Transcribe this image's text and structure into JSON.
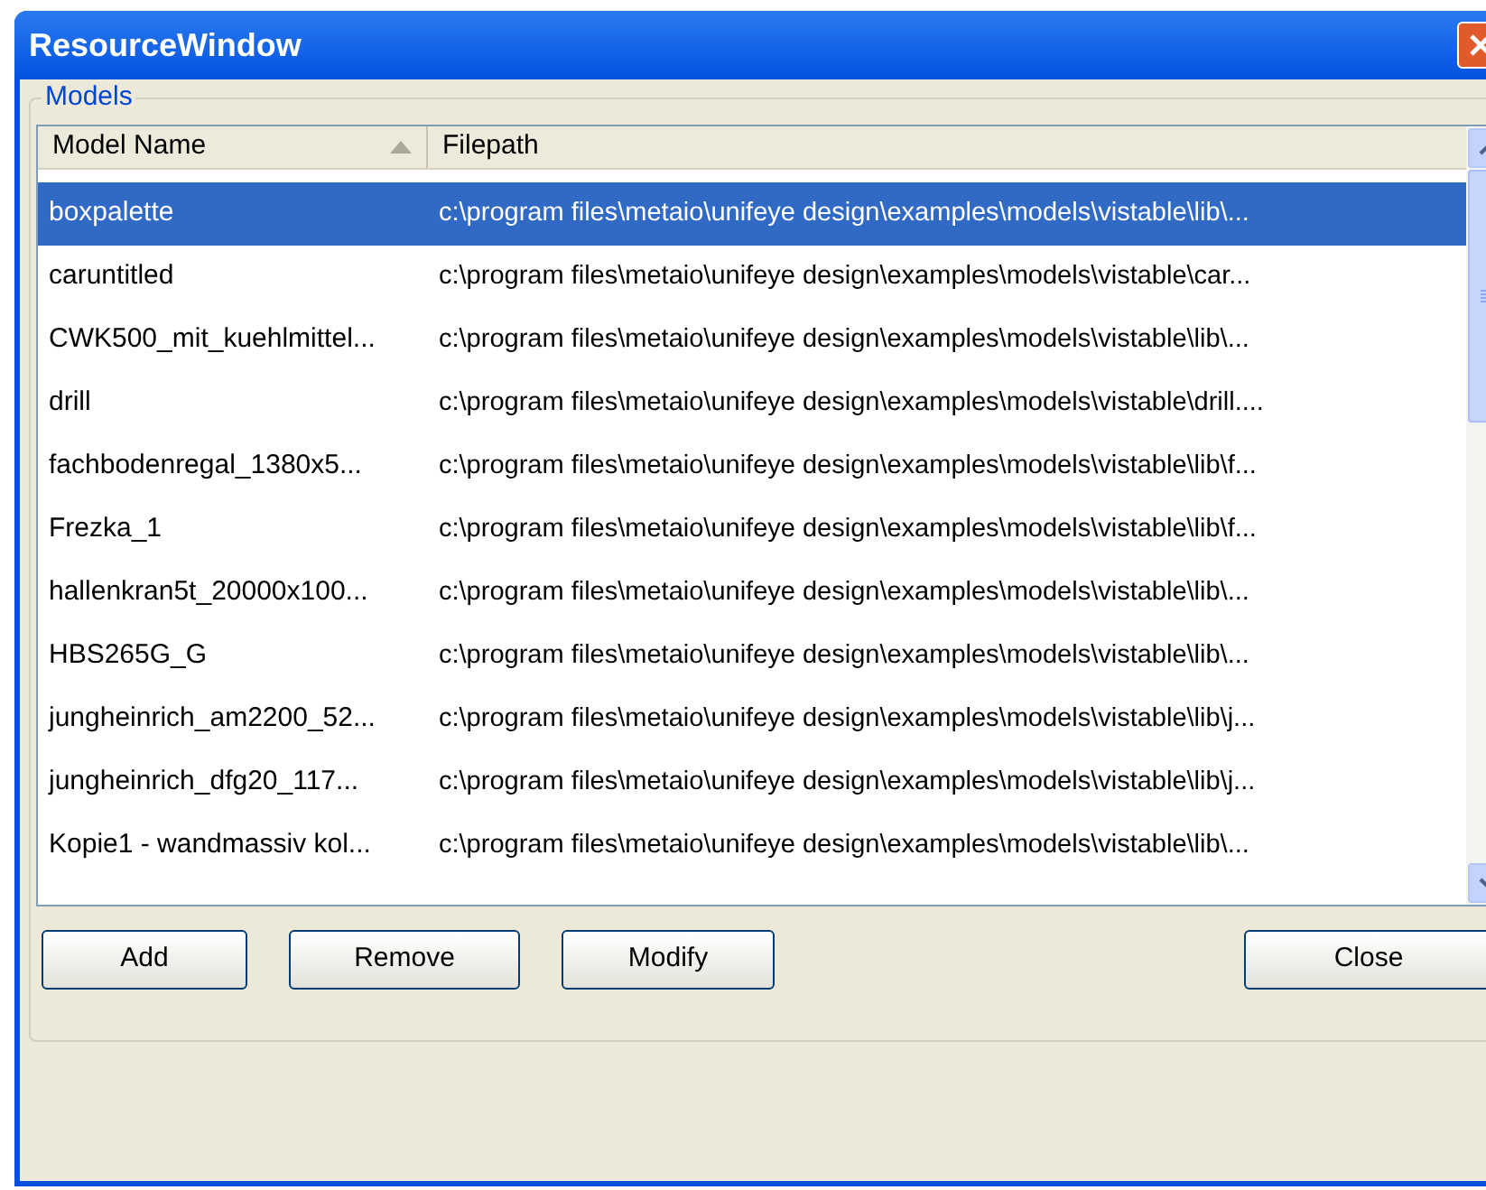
{
  "window": {
    "title": "ResourceWindow"
  },
  "group": {
    "label": "Models"
  },
  "table": {
    "columns": [
      {
        "label": "Model Name",
        "sorted": true
      },
      {
        "label": "Filepath",
        "sorted": false
      }
    ],
    "rows": [
      {
        "name": "boxpalette",
        "path": "c:\\program files\\metaio\\unifeye design\\examples\\models\\vistable\\lib\\...",
        "selected": true
      },
      {
        "name": "caruntitled",
        "path": "c:\\program files\\metaio\\unifeye design\\examples\\models\\vistable\\car...",
        "selected": false
      },
      {
        "name": "CWK500_mit_kuehlmittel...",
        "path": "c:\\program files\\metaio\\unifeye design\\examples\\models\\vistable\\lib\\...",
        "selected": false
      },
      {
        "name": "drill",
        "path": "c:\\program files\\metaio\\unifeye design\\examples\\models\\vistable\\drill....",
        "selected": false
      },
      {
        "name": "fachbodenregal_1380x5...",
        "path": "c:\\program files\\metaio\\unifeye design\\examples\\models\\vistable\\lib\\f...",
        "selected": false
      },
      {
        "name": "Frezka_1",
        "path": "c:\\program files\\metaio\\unifeye design\\examples\\models\\vistable\\lib\\f...",
        "selected": false
      },
      {
        "name": "hallenkran5t_20000x100...",
        "path": "c:\\program files\\metaio\\unifeye design\\examples\\models\\vistable\\lib\\...",
        "selected": false
      },
      {
        "name": "HBS265G_G",
        "path": "c:\\program files\\metaio\\unifeye design\\examples\\models\\vistable\\lib\\...",
        "selected": false
      },
      {
        "name": "jungheinrich_am2200_52...",
        "path": "c:\\program files\\metaio\\unifeye design\\examples\\models\\vistable\\lib\\j...",
        "selected": false
      },
      {
        "name": "jungheinrich_dfg20_117...",
        "path": "c:\\program files\\metaio\\unifeye design\\examples\\models\\vistable\\lib\\j...",
        "selected": false
      },
      {
        "name": "Kopie1 - wandmassiv kol...",
        "path": "c:\\program files\\metaio\\unifeye design\\examples\\models\\vistable\\lib\\...",
        "selected": false
      }
    ]
  },
  "left_buttons": [
    "Add",
    "Remove",
    "Modify"
  ],
  "right_buttons": [
    "Close"
  ]
}
